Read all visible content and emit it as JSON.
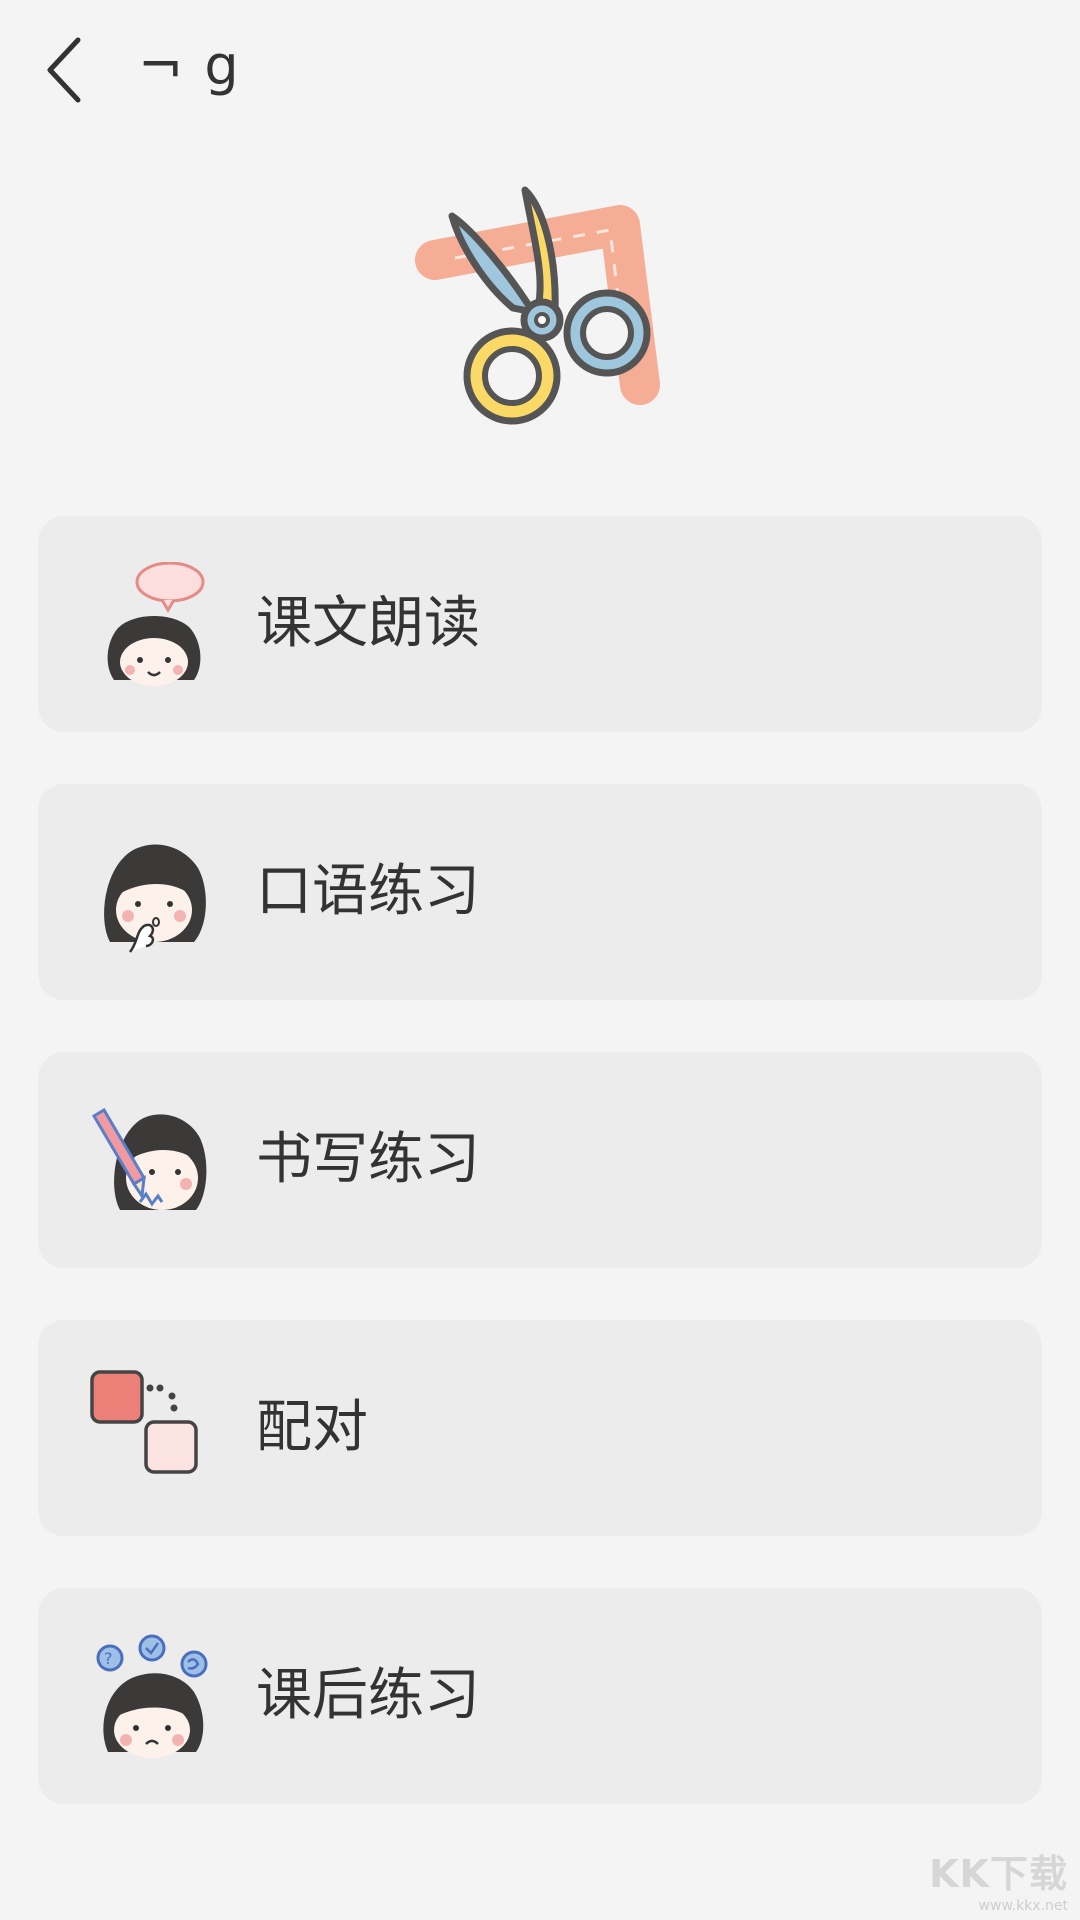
{
  "header": {
    "title": "¬ g"
  },
  "menu": {
    "items": [
      {
        "label": "课文朗读",
        "icon": "girl-speech-bubble-icon"
      },
      {
        "label": "口语练习",
        "icon": "girl-thinking-icon"
      },
      {
        "label": "书写练习",
        "icon": "girl-pencil-icon"
      },
      {
        "label": "配对",
        "icon": "matching-squares-icon"
      },
      {
        "label": "课后练习",
        "icon": "girl-question-bubbles-icon"
      }
    ]
  },
  "watermark": {
    "logo": "KK下载",
    "url": "www.kkx.net"
  },
  "colors": {
    "background": "#f4f4f4",
    "card": "#ececec",
    "text": "#333333"
  }
}
